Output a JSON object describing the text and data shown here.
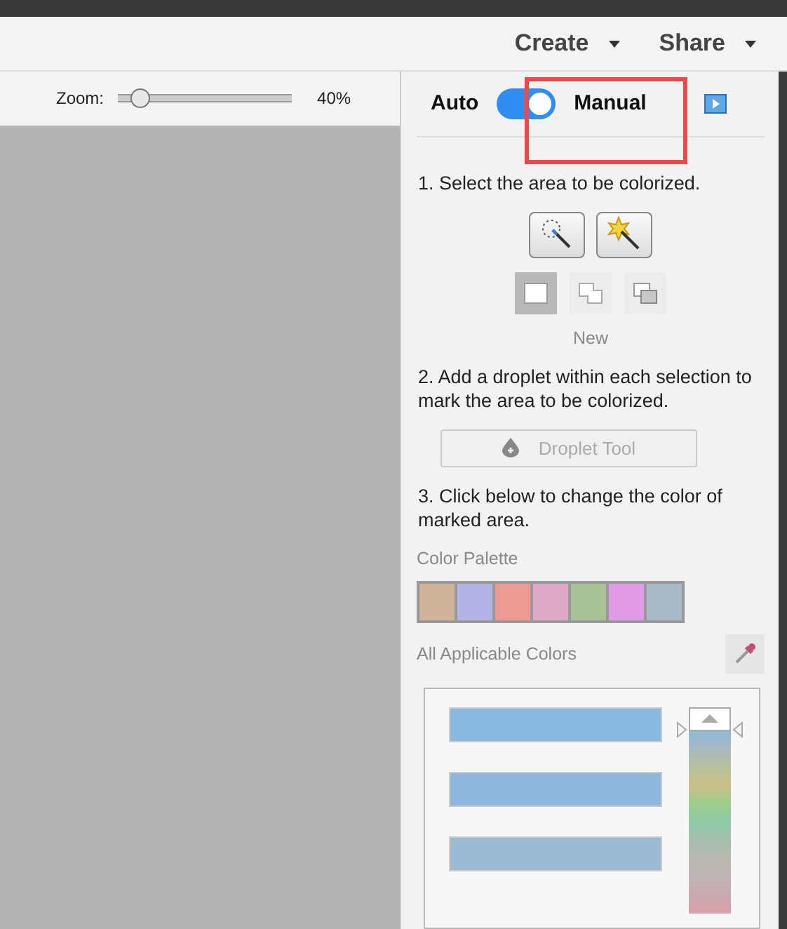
{
  "menu": [
    {
      "label": "Create"
    },
    {
      "label": "Share"
    }
  ],
  "zoom": {
    "label": "Zoom:",
    "level": 0.1,
    "reading": "40%"
  },
  "mode": {
    "left": "Auto",
    "right": "Manual",
    "on": true
  },
  "step1": {
    "text": "1. Select the area to be colorized.",
    "tools": [
      {
        "kind": "quick"
      },
      {
        "kind": "magic"
      }
    ],
    "modes": [
      {
        "kind": "new",
        "selected": true
      },
      {
        "kind": "add",
        "selected": false
      },
      {
        "kind": "subtract",
        "selected": false
      }
    ],
    "mode_label": "New"
  },
  "step2": {
    "text": "2. Add a droplet within each selection to mark the area to be colorized.",
    "button": {
      "label": "Droplet Tool",
      "disabled": true
    }
  },
  "step3": {
    "text": "3. Click below to change the color of marked area.",
    "palette_label": "Color Palette",
    "palette": [
      {
        "color": "#cfb39a"
      },
      {
        "color": "#b3b3e6"
      },
      {
        "color": "#ee9a94"
      },
      {
        "color": "#dea9c4"
      },
      {
        "color": "#a8c298"
      },
      {
        "color": "#e09ae6"
      },
      {
        "color": "#a9b9c6"
      }
    ],
    "all_label": "All Applicable Colors",
    "applicable": [
      {
        "color": "#88b9e0"
      },
      {
        "color": "#8fb6dc"
      },
      {
        "color": "#9bb9d0"
      }
    ]
  }
}
